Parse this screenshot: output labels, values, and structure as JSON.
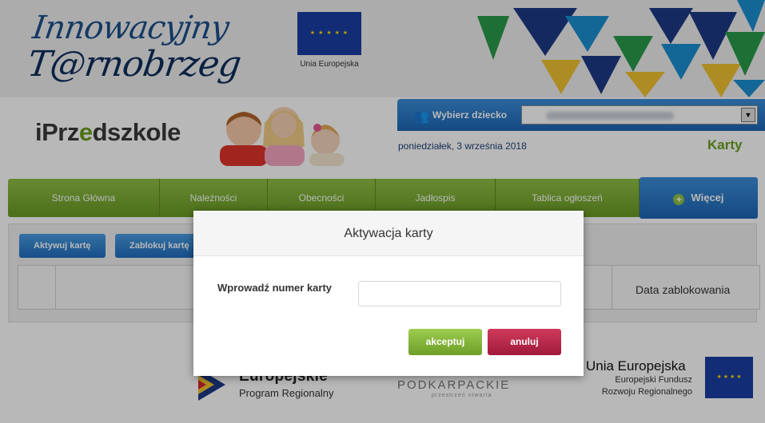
{
  "banner": {
    "logo_line1": "Innowacyjny",
    "logo_line2": "T@rnobrzeg",
    "eu_caption": "Unia Europejska"
  },
  "header": {
    "brand_prefix": "iPrz",
    "brand_highlight": "e",
    "brand_suffix": "dszkole",
    "child_label": "Wybierz dziecko",
    "date": "poniedziałek, 3 września 2018",
    "section": "Karty"
  },
  "nav": {
    "items": [
      "Strona Główna",
      "Należności",
      "Obecności",
      "Jadłospis",
      "Tablica ogłoszeń"
    ],
    "more_label": "Więcej"
  },
  "toolbar": {
    "activate_label": "Aktywuj kartę",
    "block_label": "Zablokuj kartę"
  },
  "table": {
    "columns": [
      "",
      "",
      "Data zablokowania"
    ]
  },
  "footer": {
    "fe_title": "Europejskie",
    "fe_sub": "Program Regionalny",
    "podkarpackie": "PODKARPACKIE",
    "podkarpackie_sub": "przestrzeń otwarta",
    "ue_title": "Unia Europejska",
    "ue_sub1": "Europejski Fundusz",
    "ue_sub2": "Rozwoju Regionalnego"
  },
  "modal": {
    "title": "Aktywacja karty",
    "field_label": "Wprowadź numer karty",
    "field_value": "",
    "field_placeholder": "",
    "accept_label": "akceptuj",
    "cancel_label": "anuluj"
  },
  "colors": {
    "nav_green": "#7fb236",
    "accent_blue": "#1d66b5",
    "cancel_red": "#b8244a"
  },
  "icons": [
    "children-icon",
    "dropdown-arrow-icon",
    "plus-icon",
    "eu-flag-icon"
  ]
}
